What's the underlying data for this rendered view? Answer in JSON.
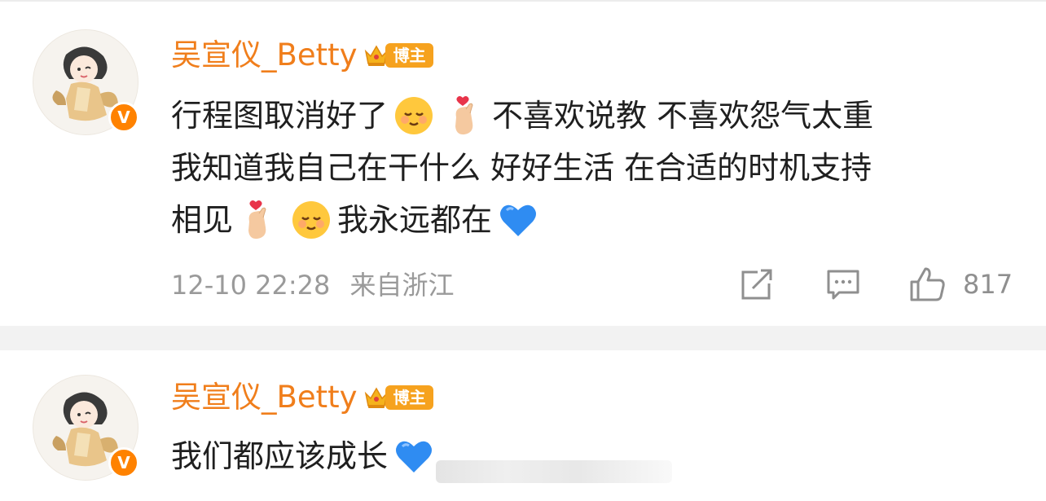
{
  "comments": [
    {
      "username": "吴宣仪_Betty",
      "badge_label": "博主",
      "lines": [
        [
          "行程图取消好了",
          "emoji:smile",
          "emoji:finger-heart",
          "不喜欢说教 不喜欢怨气太重"
        ],
        [
          "我知道我自己在干什么 好好生活 在合适的时机支持"
        ],
        [
          "相见",
          "emoji:finger-heart",
          "emoji:smile",
          "我永远都在",
          "emoji:blue-heart"
        ]
      ],
      "timestamp": "12-10 22:28",
      "location": "来自浙江",
      "likes": "817"
    },
    {
      "username": "吴宣仪_Betty",
      "badge_label": "博主",
      "lines": [
        [
          "我们都应该成长",
          "emoji:blue-heart"
        ]
      ]
    }
  ],
  "icons": {
    "verified": "V",
    "share": "share-icon",
    "comment": "comment-icon",
    "like": "thumbs-up-icon"
  },
  "colors": {
    "username": "#f07e1b",
    "badge": "#f6a21e",
    "verified": "#ff8200",
    "meta": "#9a9a9a",
    "text": "#1f1f1f"
  }
}
